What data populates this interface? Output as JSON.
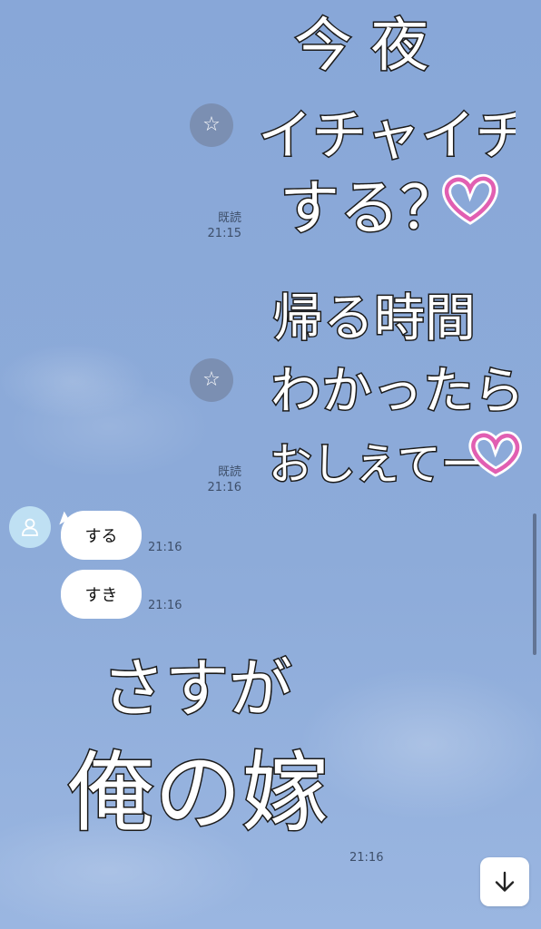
{
  "messages": [
    {
      "sender": "me",
      "type": "sticker",
      "lines": [
        "今 夜",
        "イチャイチャ",
        "する？"
      ],
      "has_heart": true,
      "read_label": "既読",
      "time": "21:15"
    },
    {
      "sender": "me",
      "type": "sticker",
      "lines": [
        "帰る時間",
        "わかったら",
        "おしえてー"
      ],
      "has_heart": true,
      "read_label": "既読",
      "time": "21:16"
    },
    {
      "sender": "other",
      "type": "text",
      "text": "する",
      "time": "21:16"
    },
    {
      "sender": "other",
      "type": "text",
      "text": "すき",
      "time": "21:16"
    },
    {
      "sender": "other",
      "type": "sticker",
      "lines": [
        "さすが",
        "俺の嫁"
      ],
      "time": "21:16"
    }
  ],
  "icons": {
    "sticker_action": "star-icon",
    "avatar": "person-icon",
    "scroll_down": "arrow-down-icon"
  },
  "colors": {
    "background": "#8eabd8",
    "bubble": "#ffffff",
    "heart": "#e15fb2",
    "avatar": "#bfe0f3"
  }
}
